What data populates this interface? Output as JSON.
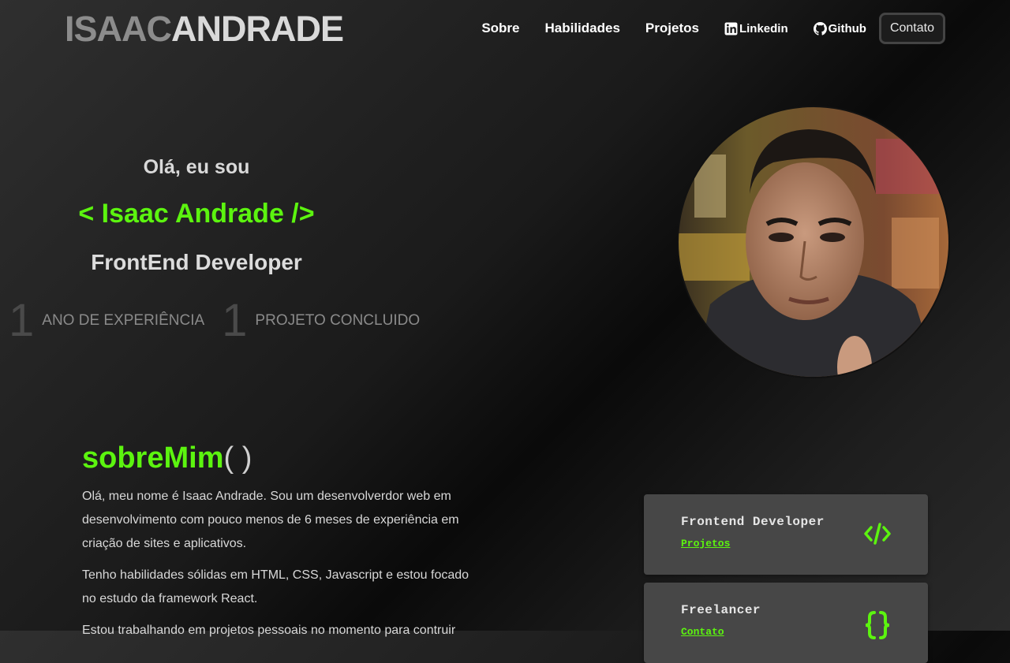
{
  "header": {
    "logo_first": "ISAAC",
    "logo_last": "ANDRADE",
    "nav": {
      "sobre": "Sobre",
      "habilidades": "Habilidades",
      "projetos": "Projetos",
      "linkedin": "Linkedin",
      "github": "Github",
      "contato": "Contato"
    }
  },
  "hero": {
    "greeting": "Olá, eu sou",
    "name": "< Isaac Andrade />",
    "role": "FrontEnd Developer",
    "stats": [
      {
        "number": "1",
        "label": "ANO DE EXPERIÊNCIA"
      },
      {
        "number": "1",
        "label": "PROJETO CONCLUIDO"
      }
    ]
  },
  "about": {
    "title_fn": "sobreMim",
    "title_parens": "( )",
    "paragraphs": [
      "Olá, meu nome é Isaac Andrade. Sou um desenvolverdor web em desenvolvimento com pouco menos de 6 meses de experiência em criação de sites e aplicativos.",
      "Tenho habilidades sólidas em HTML, CSS, Javascript e estou focado no estudo da framework React.",
      "Estou trabalhando em projetos pessoais no momento para contruir"
    ]
  },
  "cards": [
    {
      "title": "Frontend Developer",
      "link": "Projetos",
      "icon": "code-icon"
    },
    {
      "title": "Freelancer",
      "link": "Contato",
      "icon": "braces-icon"
    }
  ],
  "colors": {
    "accent": "#5cf40f",
    "card_bg": "#474747"
  }
}
